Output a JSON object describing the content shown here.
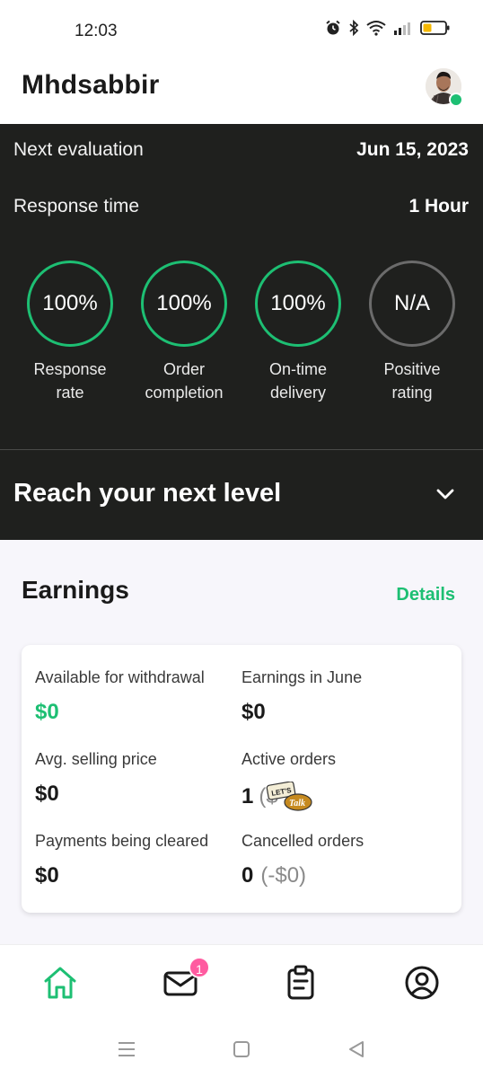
{
  "status_bar": {
    "time": "12:03"
  },
  "header": {
    "username": "Mhdsabbir"
  },
  "evaluation": {
    "next_label": "Next evaluation",
    "next_value": "Jun 15, 2023",
    "response_label": "Response time",
    "response_value": "1 Hour",
    "metrics": [
      {
        "value": "100%",
        "label_line1": "Response",
        "label_line2": "rate"
      },
      {
        "value": "100%",
        "label_line1": "Order",
        "label_line2": "completion"
      },
      {
        "value": "100%",
        "label_line1": "On-time",
        "label_line2": "delivery"
      },
      {
        "value": "N/A",
        "label_line1": "Positive",
        "label_line2": "rating"
      }
    ]
  },
  "next_level": {
    "title": "Reach your next level"
  },
  "earnings": {
    "title": "Earnings",
    "details_link": "Details",
    "available_label": "Available for withdrawal",
    "available_value": "$0",
    "june_label": "Earnings in June",
    "june_value": "$0",
    "avg_label": "Avg. selling price",
    "avg_value": "$0",
    "active_label": "Active orders",
    "active_value": "1",
    "active_suffix": "($",
    "talk_badge_line1": "LET'S",
    "talk_badge_line2": "Talk",
    "clearing_label": "Payments being cleared",
    "clearing_value": "$0",
    "cancelled_label": "Cancelled orders",
    "cancelled_value": "0",
    "cancelled_suffix": "(-$0)"
  },
  "bottom_nav": {
    "active_color": "#1dbf73",
    "inbox_badge": "1",
    "items": [
      "home-icon",
      "inbox-icon",
      "orders-icon",
      "profile-icon"
    ]
  },
  "colors": {
    "accent": "#1dbf73",
    "dark_panel": "#1f201e",
    "badge": "#ff5ba0"
  }
}
